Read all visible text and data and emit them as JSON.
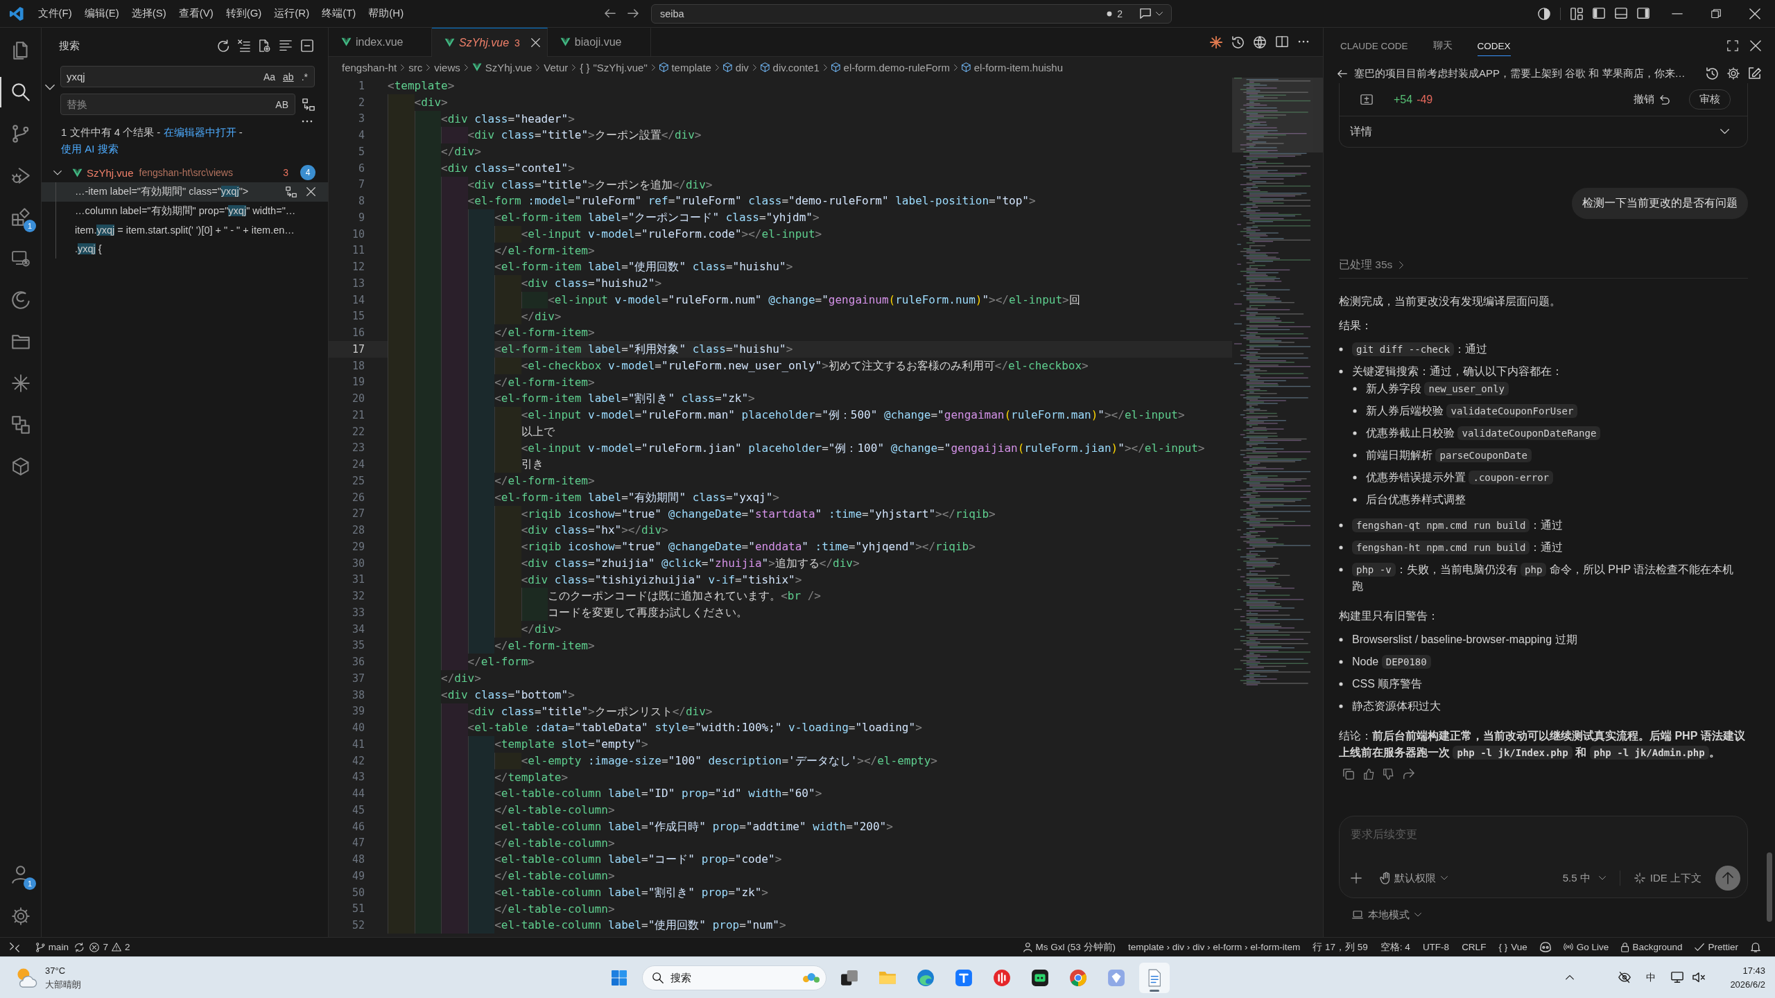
{
  "title_bar": {
    "menus": [
      "文件(F)",
      "编辑(E)",
      "选择(S)",
      "查看(V)",
      "转到(G)",
      "运行(R)",
      "终端(T)",
      "帮助(H)"
    ],
    "command_center": {
      "label": "seiba",
      "changes": "2"
    }
  },
  "activity_bar": {
    "items": [
      {
        "kind": "files",
        "selected": false
      },
      {
        "kind": "search",
        "selected": true
      },
      {
        "kind": "branch",
        "selected": false
      },
      {
        "kind": "debug",
        "selected": false
      },
      {
        "kind": "extensions",
        "selected": false,
        "badge": "1"
      },
      {
        "kind": "remote",
        "selected": false
      },
      {
        "kind": "swirl",
        "selected": false
      },
      {
        "kind": "folder",
        "selected": false
      },
      {
        "kind": "asterisk",
        "selected": false
      },
      {
        "kind": "blocks",
        "selected": false
      },
      {
        "kind": "cube",
        "selected": false
      }
    ],
    "bottom": [
      {
        "kind": "account",
        "badge": "1"
      },
      {
        "kind": "gear"
      }
    ]
  },
  "sidebar": {
    "title": "搜索",
    "search_value": "yxqj",
    "search_toggles": [
      "Aa",
      "ab",
      ".*"
    ],
    "replace_expanded": true,
    "replace_placeholder": "替换",
    "replace_toggle": "AB",
    "summary": [
      {
        "kind": "text",
        "text": "1 文件中有 4 个结果 - "
      },
      {
        "kind": "link",
        "text": "在编辑器中打开"
      },
      {
        "kind": "text",
        "text": " - "
      },
      {
        "kind": "link",
        "text": "使用 AI 搜索"
      }
    ],
    "file": {
      "name": "SzYhj.vue",
      "path": "fengshan-ht\\src\\views",
      "problems": "3",
      "count": "4",
      "expanded": true
    },
    "matches": [
      {
        "before": "…-item label=\"有効期間\" class=\"",
        "match": "yxqj",
        "after": "\">",
        "selected": true
      },
      {
        "before": "…column label=\"有効期間\" prop=\"",
        "match": "yxqj",
        "after": "\" width=\"…",
        "selected": false
      },
      {
        "before": "item.",
        "match": "yxqj",
        "after": " = item.start.split(' ')[0] + \" - \" + item.en…",
        "selected": false
      },
      {
        "before": ".",
        "match": "yxqj",
        "after": " {",
        "selected": false
      }
    ]
  },
  "editor": {
    "tabs": [
      {
        "label": "index.vue",
        "selected": false,
        "preview": false
      },
      {
        "label": "SzYhj.vue",
        "selected": true,
        "preview": true,
        "problems": "3"
      },
      {
        "label": "biaoji.vue",
        "selected": false,
        "preview": false
      }
    ],
    "breadcrumbs": [
      {
        "kind": "plain",
        "label": "fengshan-ht"
      },
      {
        "kind": "plain",
        "label": "src"
      },
      {
        "kind": "plain",
        "label": "views"
      },
      {
        "kind": "vue",
        "label": "SzYhj.vue"
      },
      {
        "kind": "plain",
        "label": "Vetur"
      },
      {
        "kind": "symbol",
        "symbol": "{ }",
        "label": "\"SzYhj.vue\""
      },
      {
        "kind": "element",
        "label": "template"
      },
      {
        "kind": "element",
        "label": "div"
      },
      {
        "kind": "element",
        "label": "div.conte1"
      },
      {
        "kind": "element",
        "label": "el-form.demo-ruleForm"
      },
      {
        "kind": "element",
        "label": "el-form-item.huishu"
      }
    ],
    "lines": [
      {
        "n": "1",
        "code": "<template>",
        "current": false
      },
      {
        "n": "2",
        "code": "    <div>",
        "current": false
      },
      {
        "n": "3",
        "code": "        <div class=\"header\">",
        "current": false
      },
      {
        "n": "4",
        "code": "            <div class=\"title\">クーポン設置</div>",
        "current": false
      },
      {
        "n": "5",
        "code": "        </div>",
        "current": false
      },
      {
        "n": "6",
        "code": "        <div class=\"conte1\">",
        "current": false
      },
      {
        "n": "7",
        "code": "            <div class=\"title\">クーポンを追加</div>",
        "current": false
      },
      {
        "n": "8",
        "code": "            <el-form :model=\"ruleForm\" ref=\"ruleForm\" class=\"demo-ruleForm\" label-position=\"top\">",
        "current": false
      },
      {
        "n": "9",
        "code": "                <el-form-item label=\"クーポンコード\" class=\"yhjdm\">",
        "current": false
      },
      {
        "n": "10",
        "code": "                    <el-input v-model=\"ruleForm.code\"></el-input>",
        "current": false
      },
      {
        "n": "11",
        "code": "                </el-form-item>",
        "current": false
      },
      {
        "n": "12",
        "code": "                <el-form-item label=\"使用回数\" class=\"huishu\">",
        "current": false
      },
      {
        "n": "13",
        "code": "                    <div class=\"huishu2\">",
        "current": false
      },
      {
        "n": "14",
        "code": "                        <el-input v-model=\"ruleForm.num\" @change=\"gengainum(ruleForm.num)\"></el-input>回",
        "current": false
      },
      {
        "n": "15",
        "code": "                    </div>",
        "current": false
      },
      {
        "n": "16",
        "code": "                </el-form-item>",
        "current": false
      },
      {
        "n": "17",
        "code": "                <el-form-item label=\"利用対象\" class=\"huishu\">",
        "current": true
      },
      {
        "n": "18",
        "code": "                    <el-checkbox v-model=\"ruleForm.new_user_only\">初めて注文するお客様のみ利用可</el-checkbox>",
        "current": false
      },
      {
        "n": "19",
        "code": "                </el-form-item>",
        "current": false
      },
      {
        "n": "20",
        "code": "                <el-form-item label=\"割引き\" class=\"zk\">",
        "current": false
      },
      {
        "n": "21",
        "code": "                    <el-input v-model=\"ruleForm.man\" placeholder=\"例：500\" @change=\"gengaiman(ruleForm.man)\"></el-input>",
        "current": false
      },
      {
        "n": "22",
        "code": "                    以上で",
        "current": false
      },
      {
        "n": "23",
        "code": "                    <el-input v-model=\"ruleForm.jian\" placeholder=\"例：100\" @change=\"gengaijian(ruleForm.jian)\"></el-input>",
        "current": false
      },
      {
        "n": "24",
        "code": "                    引き",
        "current": false
      },
      {
        "n": "25",
        "code": "                </el-form-item>",
        "current": false
      },
      {
        "n": "26",
        "code": "                <el-form-item label=\"有効期間\" class=\"yxqj\">",
        "current": false
      },
      {
        "n": "27",
        "code": "                    <riqib icoshow=\"true\" @changeDate=\"startdata\" :time=\"yhjstart\"></riqib>",
        "current": false
      },
      {
        "n": "28",
        "code": "                    <div class=\"hx\"></div>",
        "current": false
      },
      {
        "n": "29",
        "code": "                    <riqib icoshow=\"true\" @changeDate=\"enddata\" :time=\"yhjqend\"></riqib>",
        "current": false
      },
      {
        "n": "30",
        "code": "                    <div class=\"zhuijia\" @click=\"zhuijia\">追加する</div>",
        "current": false
      },
      {
        "n": "31",
        "code": "                    <div class=\"tishiyizhuijia\" v-if=\"tishix\">",
        "current": false
      },
      {
        "n": "32",
        "code": "                        このクーポンコードは既に追加されています。<br />",
        "current": false
      },
      {
        "n": "33",
        "code": "                        コードを変更して再度お試しください。",
        "current": false
      },
      {
        "n": "34",
        "code": "                    </div>",
        "current": false
      },
      {
        "n": "35",
        "code": "                </el-form-item>",
        "current": false
      },
      {
        "n": "36",
        "code": "            </el-form>",
        "current": false
      },
      {
        "n": "37",
        "code": "        </div>",
        "current": false
      },
      {
        "n": "38",
        "code": "        <div class=\"bottom\">",
        "current": false
      },
      {
        "n": "39",
        "code": "            <div class=\"title\">クーポンリスト</div>",
        "current": false
      },
      {
        "n": "40",
        "code": "            <el-table :data=\"tableData\" style=\"width:100%;\" v-loading=\"loading\">",
        "current": false
      },
      {
        "n": "41",
        "code": "                <template slot=\"empty\">",
        "current": false
      },
      {
        "n": "42",
        "code": "                    <el-empty :image-size=\"100\" description='データなし'></el-empty>",
        "current": false
      },
      {
        "n": "43",
        "code": "                </template>",
        "current": false
      },
      {
        "n": "44",
        "code": "                <el-table-column label=\"ID\" prop=\"id\" width=\"60\">",
        "current": false
      },
      {
        "n": "45",
        "code": "                </el-table-column>",
        "current": false
      },
      {
        "n": "46",
        "code": "                <el-table-column label=\"作成日時\" prop=\"addtime\" width=\"200\">",
        "current": false
      },
      {
        "n": "47",
        "code": "                </el-table-column>",
        "current": false
      },
      {
        "n": "48",
        "code": "                <el-table-column label=\"コード\" prop=\"code\">",
        "current": false
      },
      {
        "n": "49",
        "code": "                </el-table-column>",
        "current": false
      },
      {
        "n": "50",
        "code": "                <el-table-column label=\"割引き\" prop=\"zk\">",
        "current": false
      },
      {
        "n": "51",
        "code": "                </el-table-column>",
        "current": false
      },
      {
        "n": "52",
        "code": "                <el-table-column label=\"使用回数\" prop=\"num\">",
        "current": false
      }
    ]
  },
  "chat_panel": {
    "tabs": [
      {
        "label": "CLAUDE CODE",
        "selected": false
      },
      {
        "label": "聊天",
        "selected": false
      },
      {
        "label": "CODEX",
        "selected": true
      }
    ],
    "thread_title": "塞巴的项目目前考虑封装成APP，需要上架到 谷歌 和 苹果商店，你来…",
    "change_card": {
      "added": "+54",
      "removed": "-49",
      "undo": "撤销",
      "review": "审核",
      "details": "详情",
      "expanded": false
    },
    "user_message": "检测一下当前更改的是否有问题",
    "processed": "已处理 35s",
    "response": [
      {
        "kind": "paragraph",
        "segments": [
          {
            "kind": "text",
            "text": "检测完成，当前更改没有发现编译层面问题。"
          }
        ]
      },
      {
        "kind": "paragraph",
        "segments": [
          {
            "kind": "text",
            "text": "结果："
          }
        ]
      },
      {
        "kind": "list",
        "items": [
          {
            "segments": [
              {
                "kind": "code",
                "text": "git diff --check"
              },
              {
                "kind": "text",
                "text": "：通过"
              }
            ]
          },
          {
            "segments": [
              {
                "kind": "text",
                "text": "关键逻辑搜索：通过，确认以下内容都在："
              }
            ],
            "children": [
              {
                "segments": [
                  {
                    "kind": "text",
                    "text": "新人券字段 "
                  },
                  {
                    "kind": "code",
                    "text": "new_user_only"
                  }
                ]
              },
              {
                "segments": [
                  {
                    "kind": "text",
                    "text": "新人券后端校验 "
                  },
                  {
                    "kind": "code",
                    "text": "validateCouponForUser"
                  }
                ]
              },
              {
                "segments": [
                  {
                    "kind": "text",
                    "text": "优惠券截止日校验 "
                  },
                  {
                    "kind": "code",
                    "text": "validateCouponDateRange"
                  }
                ]
              },
              {
                "segments": [
                  {
                    "kind": "text",
                    "text": "前端日期解析 "
                  },
                  {
                    "kind": "code",
                    "text": "parseCouponDate"
                  }
                ]
              },
              {
                "segments": [
                  {
                    "kind": "text",
                    "text": "优惠券错误提示外置 "
                  },
                  {
                    "kind": "code",
                    "text": ".coupon-error"
                  }
                ]
              },
              {
                "segments": [
                  {
                    "kind": "text",
                    "text": "后台优惠券样式调整"
                  }
                ]
              }
            ]
          },
          {
            "segments": [
              {
                "kind": "code",
                "text": "fengshan-qt npm.cmd run build"
              },
              {
                "kind": "text",
                "text": "：通过"
              }
            ]
          },
          {
            "segments": [
              {
                "kind": "code",
                "text": "fengshan-ht npm.cmd run build"
              },
              {
                "kind": "text",
                "text": "：通过"
              }
            ]
          },
          {
            "segments": [
              {
                "kind": "code",
                "text": "php -v"
              },
              {
                "kind": "text",
                "text": "：失败，当前电脑仍没有 "
              },
              {
                "kind": "code",
                "text": "php"
              },
              {
                "kind": "text",
                "text": " 命令，所以 PHP 语法检查不能在本机跑"
              }
            ]
          }
        ]
      },
      {
        "kind": "paragraph",
        "segments": [
          {
            "kind": "text",
            "text": "构建里只有旧警告："
          }
        ]
      },
      {
        "kind": "list",
        "items": [
          {
            "segments": [
              {
                "kind": "text",
                "text": "Browserslist / baseline-browser-mapping 过期"
              }
            ]
          },
          {
            "segments": [
              {
                "kind": "text",
                "text": "Node "
              },
              {
                "kind": "code",
                "text": "DEP0180"
              }
            ]
          },
          {
            "segments": [
              {
                "kind": "text",
                "text": "CSS 顺序警告"
              }
            ]
          },
          {
            "segments": [
              {
                "kind": "text",
                "text": "静态资源体积过大"
              }
            ]
          }
        ]
      },
      {
        "kind": "paragraph",
        "segments": [
          {
            "kind": "text",
            "text": "结论："
          },
          {
            "kind": "bold",
            "text": "前后台前端构建正常，当前改动可以继续测试真实流程。后端 PHP 语法建议上线前在服务器跑一次 "
          },
          {
            "kind": "bold_code",
            "text": "php -l jk/Index.php"
          },
          {
            "kind": "bold",
            "text": " 和 "
          },
          {
            "kind": "bold_code",
            "text": "php -l jk/Admin.php"
          },
          {
            "kind": "bold",
            "text": "。"
          }
        ]
      }
    ],
    "composer": {
      "placeholder": "要求后续变更",
      "permission": "默认权限",
      "model": "5.5 中",
      "context": "IDE 上下文",
      "send_disabled": true,
      "mode": "本地模式"
    }
  },
  "status_bar": {
    "branch": "main",
    "errors": "7",
    "warnings": "2",
    "items": [
      {
        "kind": "blame",
        "text": "Ms Gxl (53 分钟前)"
      },
      {
        "kind": "plain",
        "text": "template › div › div › el-form › el-form-item"
      },
      {
        "kind": "plain",
        "text": "行 17，列 59"
      },
      {
        "kind": "plain",
        "text": "空格: 4"
      },
      {
        "kind": "plain",
        "text": "UTF-8"
      },
      {
        "kind": "plain",
        "text": "CRLF"
      },
      {
        "kind": "language",
        "symbol": "{ }",
        "text": "Vue"
      },
      {
        "kind": "copilot"
      },
      {
        "kind": "golive",
        "text": "Go Live"
      },
      {
        "kind": "background",
        "text": "Background"
      },
      {
        "kind": "prettier",
        "text": "Prettier"
      },
      {
        "kind": "bell"
      }
    ]
  },
  "taskbar": {
    "weather": {
      "temperature": "37°C",
      "description": "大部晴朗"
    },
    "apps": [
      {
        "kind": "start",
        "selected": false
      },
      {
        "kind": "search",
        "placeholder": "搜索",
        "selected": false
      },
      {
        "kind": "taskview",
        "selected": false
      },
      {
        "kind": "folder",
        "selected": false
      },
      {
        "kind": "swirl",
        "selected": false
      },
      {
        "kind": "tile",
        "selected": false
      },
      {
        "kind": "round",
        "selected": false
      },
      {
        "kind": "robot",
        "selected": false
      },
      {
        "kind": "wheel",
        "selected": false
      },
      {
        "kind": "gem",
        "selected": false
      },
      {
        "kind": "notepad",
        "selected": true
      }
    ],
    "ime": "中",
    "time": "17:43",
    "date": "2026/6/2"
  }
}
